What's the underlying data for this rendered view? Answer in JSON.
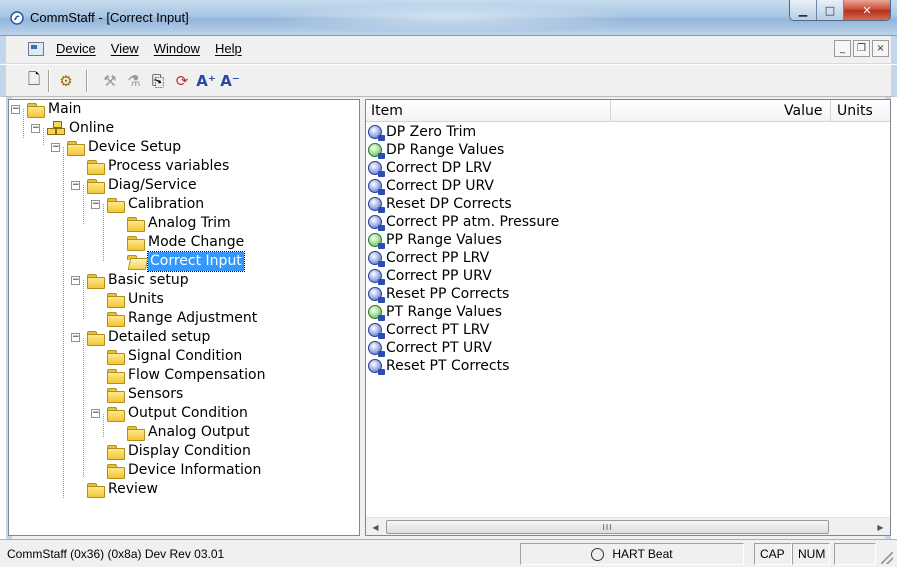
{
  "window": {
    "title": "CommStaff - [Correct Input]",
    "minimize_glyph": "▁",
    "maximize_glyph": "□",
    "close_glyph": "✕"
  },
  "menu": {
    "items": [
      "Device",
      "View",
      "Window",
      "Help"
    ],
    "mdi_minimize": "_",
    "mdi_restore": "❐",
    "mdi_close": "×"
  },
  "toolbar": {
    "buttons": [
      {
        "icon": "new-document-icon",
        "glyph": "🗋",
        "enabled": true
      },
      {
        "icon": "connect-icon",
        "glyph": "⚙",
        "enabled": true
      },
      {
        "icon": "device-settings-icon",
        "glyph": "⚒",
        "enabled": false
      },
      {
        "icon": "device-compare-icon",
        "glyph": "⚗",
        "enabled": false
      },
      {
        "icon": "save-device-icon",
        "glyph": "⎘",
        "enabled": true
      },
      {
        "icon": "refresh-device-icon",
        "glyph": "⟳",
        "enabled": true
      },
      {
        "icon": "font-increase-icon",
        "glyph": "A⁺",
        "enabled": true
      },
      {
        "icon": "font-decrease-icon",
        "glyph": "A⁻",
        "enabled": true
      }
    ]
  },
  "tree": {
    "expander_minus": "−",
    "nodes": [
      {
        "label": "Main",
        "level": 0,
        "expanded": true
      },
      {
        "label": "Online",
        "level": 1,
        "expanded": true
      },
      {
        "label": "Device Setup",
        "level": 2,
        "expanded": true
      },
      {
        "label": "Process variables",
        "level": 3
      },
      {
        "label": "Diag/Service",
        "level": 3,
        "expanded": true
      },
      {
        "label": "Calibration",
        "level": 4,
        "expanded": true
      },
      {
        "label": "Analog Trim",
        "level": 5
      },
      {
        "label": "Mode Change",
        "level": 5
      },
      {
        "label": "Correct Input",
        "level": 5,
        "selected": true
      },
      {
        "label": "Basic setup",
        "level": 3,
        "expanded": true
      },
      {
        "label": "Units",
        "level": 4
      },
      {
        "label": "Range Adjustment",
        "level": 4
      },
      {
        "label": "Detailed setup",
        "level": 3,
        "expanded": true
      },
      {
        "label": "Signal Condition",
        "level": 4
      },
      {
        "label": "Flow Compensation",
        "level": 4
      },
      {
        "label": "Sensors",
        "level": 4
      },
      {
        "label": "Output Condition",
        "level": 4,
        "expanded": true
      },
      {
        "label": "Analog Output",
        "level": 5
      },
      {
        "label": "Display Condition",
        "level": 4
      },
      {
        "label": "Device Information",
        "level": 4
      },
      {
        "label": "Review",
        "level": 3
      }
    ]
  },
  "list": {
    "columns": [
      "Item",
      "Value",
      "Units"
    ],
    "rows": [
      {
        "label": "DP Zero Trim",
        "icon": "method-icon"
      },
      {
        "label": "DP Range Values",
        "icon": "edit-icon"
      },
      {
        "label": "Correct DP LRV",
        "icon": "method-icon"
      },
      {
        "label": "Correct DP URV",
        "icon": "method-icon"
      },
      {
        "label": "Reset DP Corrects",
        "icon": "method-icon"
      },
      {
        "label": "Correct PP atm. Pressure",
        "icon": "method-icon"
      },
      {
        "label": "PP Range Values",
        "icon": "edit-icon"
      },
      {
        "label": "Correct PP LRV",
        "icon": "method-icon"
      },
      {
        "label": "Correct PP URV",
        "icon": "method-icon"
      },
      {
        "label": "Reset PP Corrects",
        "icon": "method-icon"
      },
      {
        "label": "PT Range Values",
        "icon": "edit-icon"
      },
      {
        "label": "Correct PT LRV",
        "icon": "method-icon"
      },
      {
        "label": "Correct PT URV",
        "icon": "method-icon"
      },
      {
        "label": "Reset PT Corrects",
        "icon": "method-icon"
      }
    ],
    "scroll_left": "◀",
    "scroll_right": "▶",
    "thumb_grip": "III"
  },
  "status": {
    "device": "CommStaff  (0x36)  (0x8a) Dev Rev 03.01",
    "heartbeat": "HART Beat",
    "cap": "CAP",
    "num": "NUM"
  }
}
